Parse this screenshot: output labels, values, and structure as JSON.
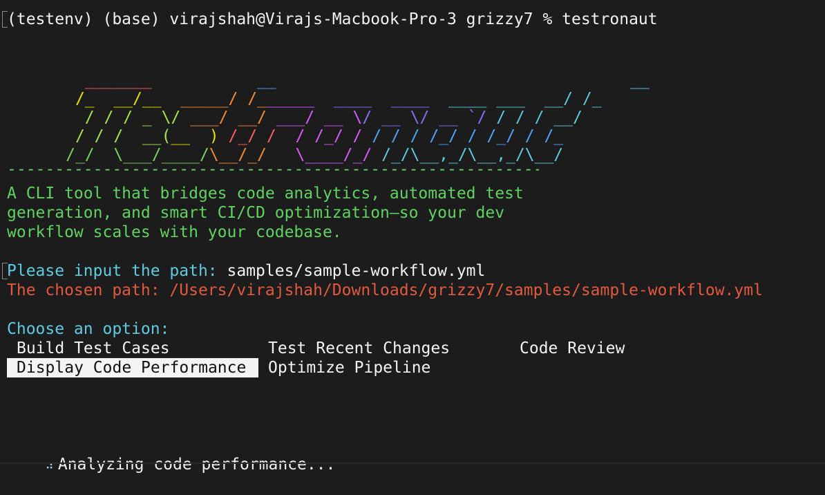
{
  "terminal": {
    "prompt_line": "(testenv) (base) virajshah@Virajs-Macbook-Pro-3 grizzy7 % testronaut",
    "logo_lines": [
      "  _______           __                                      __",
      " /_  __/__  _____/ /______  ____  ____  ____ ___  __/ /_",
      "  / / / _ \\/ ___/ __/ ___/ __ \\/ __ \\/ __ `/ / / / __/",
      " / / /  __(__  ) /_/ /  / /_/ / / / / /_/ / /_/ / /_",
      "/_/  \\___/____/\\__/_/   \\____/_/ /_/\\__,_/\\__,_/\\__/"
    ],
    "divider": "------------------------------------------------------------------------------------",
    "description": [
      "A CLI tool that bridges code analytics, automated test",
      "generation, and smart CI/CD optimization—so your dev",
      "workflow scales with your codebase."
    ],
    "path_prompt_label": "Please input the path:",
    "path_prompt_value": " samples/sample-workflow.yml",
    "chosen_path_label": "The chosen path: ",
    "chosen_path_value": "/Users/virajshah/Downloads/grizzy7/samples/sample-workflow.yml",
    "choose_label": "Choose an option:",
    "options": [
      "Build Test Cases",
      "Test Recent Changes",
      "Code Review",
      "Display Code Performance",
      "Optimize Pipeline"
    ],
    "selected_option": "Display Code Performance",
    "status_text": "Analyzing code performance...",
    "spinner": "⠴"
  },
  "colors": {
    "background": "#1c1c1c",
    "green": "#5fd35f",
    "cyan": "#5ecbe0",
    "red": "#e2593e",
    "selected_bg": "#f4f4f4"
  }
}
